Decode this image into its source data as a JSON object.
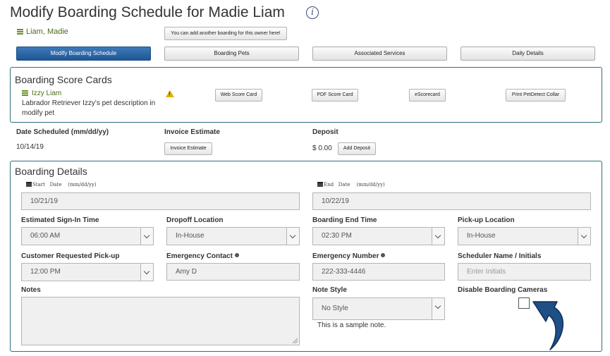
{
  "page": {
    "title": "Modify Boarding Schedule for Madie Liam",
    "owner_link": "Liam, Madie",
    "add_boarding_button": "You can add another boarding for this owner here!"
  },
  "tabs": [
    {
      "label": "Modify Boarding Schedule",
      "active": true
    },
    {
      "label": "Boarding Pets",
      "active": false
    },
    {
      "label": "Associated Services",
      "active": false
    },
    {
      "label": "Daily Details",
      "active": false
    }
  ],
  "score_cards": {
    "title": "Boarding Score Cards",
    "pet_name": "Izzy Liam",
    "pet_description": "Labrador Retriever Izzy's pet description in modify pet",
    "warning_icon": "warning-icon",
    "buttons": {
      "web": "Web Score Card",
      "pdf": "PDF Score Card",
      "escorecard": "eScorecard",
      "print_collar": "Print PetDetect Collar"
    }
  },
  "summary": {
    "date_scheduled_label": "Date Scheduled (mm/dd/yy)",
    "date_scheduled_value": "10/14/19",
    "invoice_label": "Invoice Estimate",
    "invoice_button": "Invoice Estimate",
    "deposit_label": "Deposit",
    "deposit_value": "$ 0.00",
    "add_deposit_button": "Add Deposit"
  },
  "details": {
    "title": "Boarding Details",
    "start_label_a": "Start",
    "start_label_b": "Date",
    "start_label_c": "(mm/dd/yy)",
    "start_value": "10/21/19",
    "end_label_a": "End",
    "end_label_b": "Date",
    "end_label_c": "(mm/dd/yy)",
    "end_value": "10/22/19",
    "signin_label": "Estimated Sign-In Time",
    "signin_value": "06:00 AM",
    "dropoff_label": "Dropoff Location",
    "dropoff_value": "In-House",
    "endtime_label": "Boarding End Time",
    "endtime_value": "02:30 PM",
    "pickup_loc_label": "Pick-up Location",
    "pickup_loc_value": "In-House",
    "cust_pickup_label": "Customer Requested Pick-up",
    "cust_pickup_value": "12:00 PM",
    "emergency_contact_label": "Emergency Contact",
    "emergency_contact_value": "Amy D",
    "emergency_number_label": "Emergency Number",
    "emergency_number_value": "222-333-4446",
    "scheduler_label": "Scheduler Name / Initials",
    "scheduler_placeholder": "Enter Initials",
    "notes_label": "Notes",
    "notes_value": "",
    "note_style_label": "Note Style",
    "note_style_value": "No Style",
    "sample_note": "This is a sample note.",
    "disable_cameras_label": "Disable Boarding Cameras",
    "disable_cameras_checked": false
  },
  "colors": {
    "accent_blue": "#1f5796",
    "panel_border": "#2f6f7a",
    "owner_green": "#4d6b1a",
    "warning": "#e0b000",
    "annotation_arrow": "#1e4f86"
  }
}
